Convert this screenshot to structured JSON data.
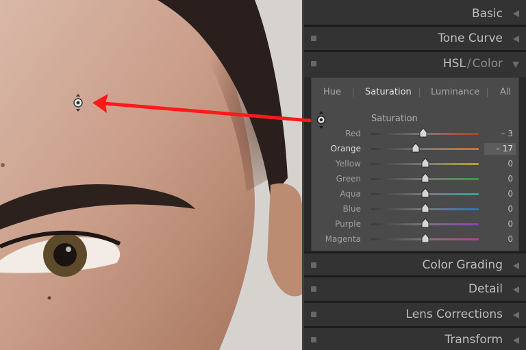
{
  "panels": {
    "basic": "Basic",
    "tone_curve": "Tone Curve",
    "hsl_main": "HSL",
    "hsl_sep": "/",
    "hsl_sub": "Color",
    "color_grading": "Color Grading",
    "detail": "Detail",
    "lens_corrections": "Lens Corrections",
    "transform": "Transform"
  },
  "tabs": [
    "Hue",
    "Saturation",
    "Luminance",
    "All"
  ],
  "active_tab": "Saturation",
  "section_title": "Saturation",
  "sliders": [
    {
      "label": "Red",
      "value": "– 3",
      "position": -3,
      "color": "#c0392b"
    },
    {
      "label": "Orange",
      "value": "– 17",
      "position": -17,
      "color": "#c8792a"
    },
    {
      "label": "Yellow",
      "value": "0",
      "position": 0,
      "color": "#b8a32c"
    },
    {
      "label": "Green",
      "value": "0",
      "position": 0,
      "color": "#3f9a3c"
    },
    {
      "label": "Aqua",
      "value": "0",
      "position": 0,
      "color": "#2aa79d"
    },
    {
      "label": "Blue",
      "value": "0",
      "position": 0,
      "color": "#2f6fc4"
    },
    {
      "label": "Purple",
      "value": "0",
      "position": 0,
      "color": "#8a3fc0"
    },
    {
      "label": "Magenta",
      "value": "0",
      "position": 0,
      "color": "#c23a93"
    }
  ],
  "colors": {
    "arrow": "#ff1a1a"
  },
  "icons": [
    "targeted-adjustment-icon",
    "collapse-triangle-icon",
    "expand-triangle-icon",
    "panel-switch-icon"
  ]
}
